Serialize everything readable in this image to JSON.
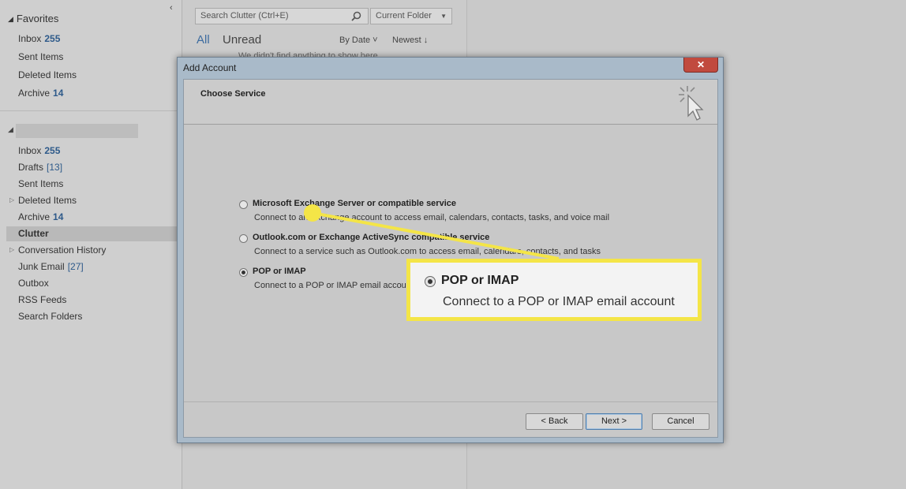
{
  "folder_pane": {
    "collapse_arrow": "‹",
    "favorites_header": "Favorites",
    "favorites": [
      {
        "label": "Inbox",
        "count": "255"
      },
      {
        "label": "Sent Items",
        "count": ""
      },
      {
        "label": "Deleted Items",
        "count": ""
      },
      {
        "label": "Archive",
        "count": "14"
      }
    ],
    "account_folders": [
      {
        "label": "Inbox",
        "count": "255"
      },
      {
        "label": "Drafts",
        "bracket_count": "[13]"
      },
      {
        "label": "Sent Items"
      },
      {
        "label": "Deleted Items"
      },
      {
        "label": "Archive",
        "count": "14"
      },
      {
        "label": "Clutter",
        "selected": true
      },
      {
        "label": "Conversation History"
      },
      {
        "label": "Junk Email",
        "bracket_count": "[27]"
      },
      {
        "label": "Outbox"
      },
      {
        "label": "RSS Feeds"
      },
      {
        "label": "Search Folders"
      }
    ]
  },
  "list_pane": {
    "search_placeholder": "Search Clutter (Ctrl+E)",
    "scope": "Current Folder",
    "tab_all": "All",
    "tab_unread": "Unread",
    "sort_by": "By Date ˅",
    "sort_order": "Newest ↓",
    "empty_message": "We didn't find anything to show here."
  },
  "dialog": {
    "title": "Add Account",
    "close": "✕",
    "heading": "Choose Service",
    "options": [
      {
        "title": "Microsoft Exchange Server or compatible service",
        "desc": "Connect to an Exchange account to access email, calendars, contacts, tasks, and voice mail",
        "selected": false
      },
      {
        "title": "Outlook.com or Exchange ActiveSync compatible service",
        "desc": "Connect to a service such as Outlook.com to access email, calendars, contacts, and tasks",
        "selected": false
      },
      {
        "title": "POP or IMAP",
        "desc": "Connect to a POP or IMAP email account",
        "selected": true
      }
    ],
    "buttons": {
      "back": "< Back",
      "next": "Next >",
      "cancel": "Cancel"
    }
  },
  "callout": {
    "title": "POP or IMAP",
    "desc": "Connect to a POP or IMAP email account",
    "color": "#f4e547"
  },
  "colors": {
    "accent": "#3d6ca0",
    "dialog_frame": "#a9bac9",
    "close_button": "#c14a3e"
  }
}
